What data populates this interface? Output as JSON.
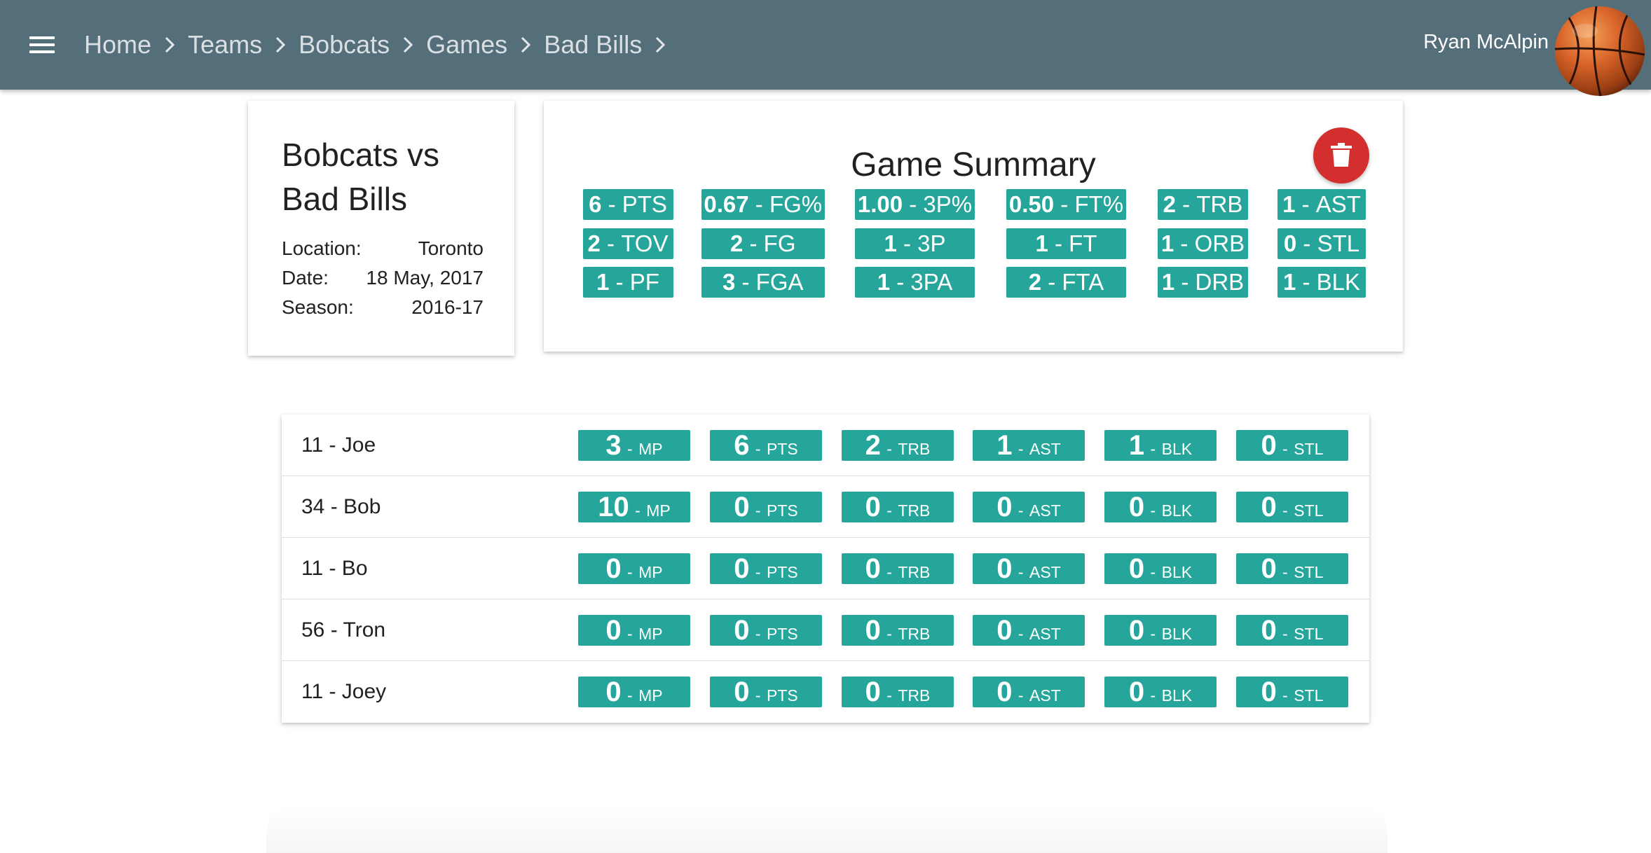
{
  "nav": {
    "breadcrumbs": [
      "Home",
      "Teams",
      "Bobcats",
      "Games",
      "Bad Bills"
    ],
    "user_name": "Ryan McAlpin",
    "avatar_icon": "basketball-icon"
  },
  "game": {
    "title_line1": "Bobcats vs",
    "title_line2": "Bad Bills",
    "location_label": "Location:",
    "location": "Toronto",
    "date_label": "Date:",
    "date": "18 May, 2017",
    "season_label": "Season:",
    "season": "2016-17"
  },
  "summary": {
    "title": "Game Summary",
    "delete_icon": "trash-icon",
    "stats": [
      [
        {
          "value": "6",
          "label": "PTS"
        },
        {
          "value": "0.67",
          "label": "FG%"
        },
        {
          "value": "1.00",
          "label": "3P%"
        },
        {
          "value": "0.50",
          "label": "FT%"
        },
        {
          "value": "2",
          "label": "TRB"
        },
        {
          "value": "1",
          "label": "AST"
        }
      ],
      [
        {
          "value": "2",
          "label": "TOV"
        },
        {
          "value": "2",
          "label": "FG"
        },
        {
          "value": "1",
          "label": "3P"
        },
        {
          "value": "1",
          "label": "FT"
        },
        {
          "value": "1",
          "label": "ORB"
        },
        {
          "value": "0",
          "label": "STL"
        }
      ],
      [
        {
          "value": "1",
          "label": "PF"
        },
        {
          "value": "3",
          "label": "FGA"
        },
        {
          "value": "1",
          "label": "3PA"
        },
        {
          "value": "2",
          "label": "FTA"
        },
        {
          "value": "1",
          "label": "DRB"
        },
        {
          "value": "1",
          "label": "BLK"
        }
      ]
    ]
  },
  "players": [
    {
      "name": "11 - Joe",
      "stats": [
        {
          "value": "3",
          "label": "MP"
        },
        {
          "value": "6",
          "label": "PTS"
        },
        {
          "value": "2",
          "label": "TRB"
        },
        {
          "value": "1",
          "label": "AST"
        },
        {
          "value": "1",
          "label": "BLK"
        },
        {
          "value": "0",
          "label": "STL"
        }
      ]
    },
    {
      "name": "34 - Bob",
      "stats": [
        {
          "value": "10",
          "label": "MP"
        },
        {
          "value": "0",
          "label": "PTS"
        },
        {
          "value": "0",
          "label": "TRB"
        },
        {
          "value": "0",
          "label": "AST"
        },
        {
          "value": "0",
          "label": "BLK"
        },
        {
          "value": "0",
          "label": "STL"
        }
      ]
    },
    {
      "name": "11 - Bo",
      "stats": [
        {
          "value": "0",
          "label": "MP"
        },
        {
          "value": "0",
          "label": "PTS"
        },
        {
          "value": "0",
          "label": "TRB"
        },
        {
          "value": "0",
          "label": "AST"
        },
        {
          "value": "0",
          "label": "BLK"
        },
        {
          "value": "0",
          "label": "STL"
        }
      ]
    },
    {
      "name": "56 - Tron",
      "stats": [
        {
          "value": "0",
          "label": "MP"
        },
        {
          "value": "0",
          "label": "PTS"
        },
        {
          "value": "0",
          "label": "TRB"
        },
        {
          "value": "0",
          "label": "AST"
        },
        {
          "value": "0",
          "label": "BLK"
        },
        {
          "value": "0",
          "label": "STL"
        }
      ]
    },
    {
      "name": "11 - Joey",
      "stats": [
        {
          "value": "0",
          "label": "MP"
        },
        {
          "value": "0",
          "label": "PTS"
        },
        {
          "value": "0",
          "label": "TRB"
        },
        {
          "value": "0",
          "label": "AST"
        },
        {
          "value": "0",
          "label": "BLK"
        },
        {
          "value": "0",
          "label": "STL"
        }
      ]
    }
  ],
  "colors": {
    "topbar": "#546e7a",
    "badge": "#26a69a",
    "delete": "#d32f2f"
  }
}
